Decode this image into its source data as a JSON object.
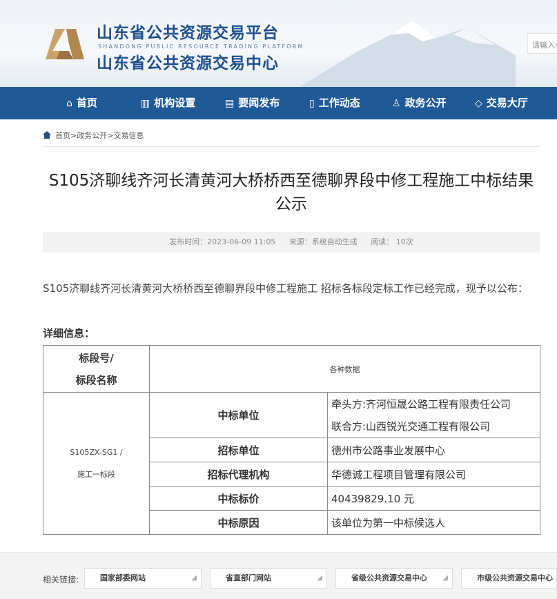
{
  "header": {
    "title_main": "山东省公共资源交易平台",
    "title_en": "SHANDONG PUBLIC RESOURCE TRADING PLATFORM",
    "title_sub": "山东省公共资源交易中心",
    "search_placeholder": "请输入关"
  },
  "nav": {
    "items": [
      {
        "label": "首页",
        "icon": "home-icon"
      },
      {
        "label": "机构设置",
        "icon": "building-icon"
      },
      {
        "label": "要闻发布",
        "icon": "news-icon"
      },
      {
        "label": "工作动态",
        "icon": "document-icon"
      },
      {
        "label": "政务公开",
        "icon": "person-icon"
      },
      {
        "label": "交易大厅",
        "icon": "diamond-icon"
      }
    ]
  },
  "breadcrumb": {
    "items": [
      "首页",
      "政务公开",
      "交易信息"
    ],
    "separator": ">"
  },
  "article": {
    "title": "S105济聊线齐河长清黄河大桥桥西至德聊界段中修工程施工中标结果公示",
    "meta": {
      "publish_time": "发布时间：2023-06-09 11:05",
      "source": "来源：系统自动生成",
      "views": "阅读： 10次"
    },
    "intro": "S105济聊线齐河长清黄河大桥桥西至德聊界段中修工程施工 招标各标段定标工作已经完成，现予以公布：",
    "detail_label": "详细信息："
  },
  "table": {
    "header_left_line1": "标段号/",
    "header_left_line2": "标段名称",
    "header_right": "各种数据",
    "section_line1": "S105ZX-SG1 /",
    "section_line2": "施工一标段",
    "rows": {
      "winner_key": "中标单位",
      "winner_lead": "牵头方:齐河恒晟公路工程有限责任公司",
      "winner_partner": "联合方:山西锐光交通工程有限公司",
      "tenderer_key": "招标单位",
      "tenderer_value": "德州市公路事业发展中心",
      "agency_key": "招标代理机构",
      "agency_value": "华德诚工程项目管理有限公司",
      "price_key": "中标标价",
      "price_value": "40439829.10 元",
      "reason_key": "中标原因",
      "reason_value": "该单位为第一中标候选人"
    }
  },
  "footer": {
    "links_label": "相关链接:",
    "selects": [
      "国家部委网站",
      "省直部门网站",
      "省级公共资源交易中心",
      "市级公共资源交易中心"
    ]
  },
  "colors": {
    "nav_bg": "#1f5a96",
    "brand_blue": "#1f4f8f"
  }
}
